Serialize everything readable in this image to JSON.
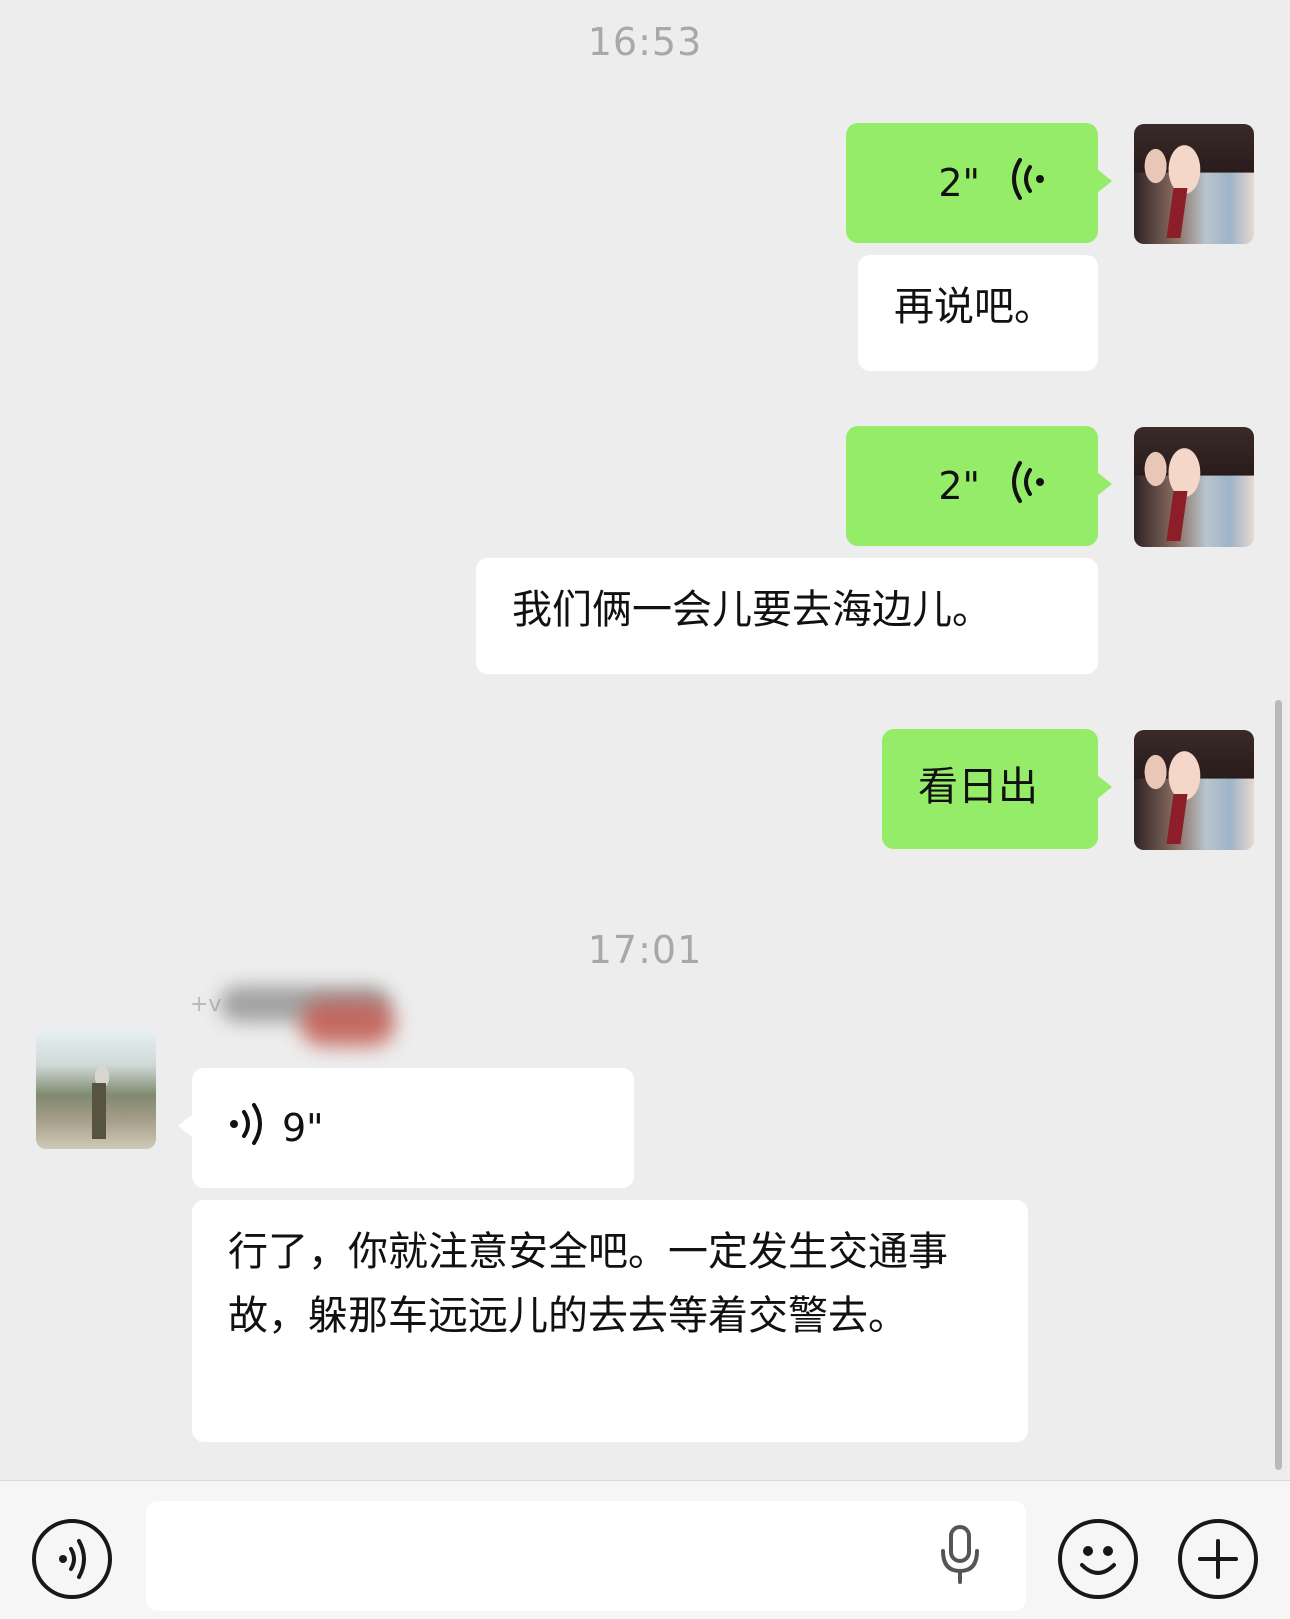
{
  "timestamps": [
    "16:53",
    "17:01"
  ],
  "messages": [
    {
      "side": "right",
      "type": "voice",
      "duration": "2\""
    },
    {
      "side": "right",
      "type": "text",
      "text": "再说吧。"
    },
    {
      "side": "right",
      "type": "voice",
      "duration": "2\""
    },
    {
      "side": "right",
      "type": "text",
      "text": "我们俩一会儿要去海边儿。"
    },
    {
      "side": "right",
      "type": "text",
      "text": "看日出"
    },
    {
      "side": "left",
      "type": "voice",
      "duration": "9\""
    },
    {
      "side": "left",
      "type": "text",
      "text": "行了，你就注意安全吧。一定发生交通事故，躲那车远远儿的去去等着交警去。"
    }
  ],
  "icons": {
    "voice_out": "voice-wave-icon",
    "voice_in": "voice-wave-icon",
    "input_voice": "voice-input-icon",
    "mic": "microphone-icon",
    "emoji": "emoji-icon",
    "more": "plus-icon"
  },
  "colors": {
    "background": "#ededed",
    "outgoing_bubble": "#95ec69",
    "incoming_bubble": "#ffffff",
    "timestamp": "#a8a8a8",
    "input_bar": "#f6f6f6"
  }
}
